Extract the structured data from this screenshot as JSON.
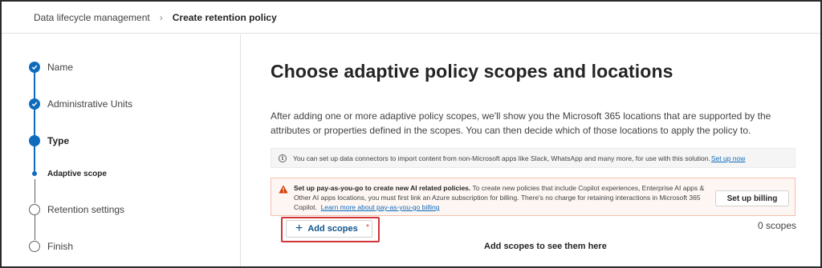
{
  "breadcrumb": {
    "parent": "Data lifecycle management",
    "current": "Create retention policy"
  },
  "steps": [
    {
      "label": "Name",
      "state": "done"
    },
    {
      "label": "Administrative Units",
      "state": "done"
    },
    {
      "label": "Type",
      "state": "current"
    },
    {
      "label": "Adaptive scope",
      "state": "sub-current"
    },
    {
      "label": "Retention settings",
      "state": "todo"
    },
    {
      "label": "Finish",
      "state": "todo"
    }
  ],
  "main": {
    "title": "Choose adaptive policy scopes and locations",
    "intro": "After adding one or more adaptive policy scopes, we'll show you the Microsoft 365 locations that are supported by the attributes or properties defined in the scopes. You can then decide which of those locations to apply the policy to.",
    "info": {
      "icon": "info-icon",
      "text": "You can set up data connectors to import content from non-Microsoft apps like Slack, WhatsApp and many more, for use with this solution.",
      "link": "Set up now"
    },
    "warning": {
      "icon": "warning-icon",
      "bold": "Set up pay-as-you-go to create new AI related policies.",
      "text": " To create new policies that include Copilot experiences, Enterprise AI apps & Other AI apps locations, you must first link an Azure subscription for billing. There's no charge for retaining interactions in Microsoft 365 Copilot.",
      "link": "Learn more about pay-as-you-go billing",
      "button": "Set up billing",
      "color": "#d83b01"
    },
    "add_scopes_label": "Add scopes",
    "required_mark": "*",
    "scope_count": "0 scopes",
    "empty_hint": "Add scopes to see them here"
  },
  "colors": {
    "accent": "#0f6cbd",
    "highlight": "#d13438"
  }
}
